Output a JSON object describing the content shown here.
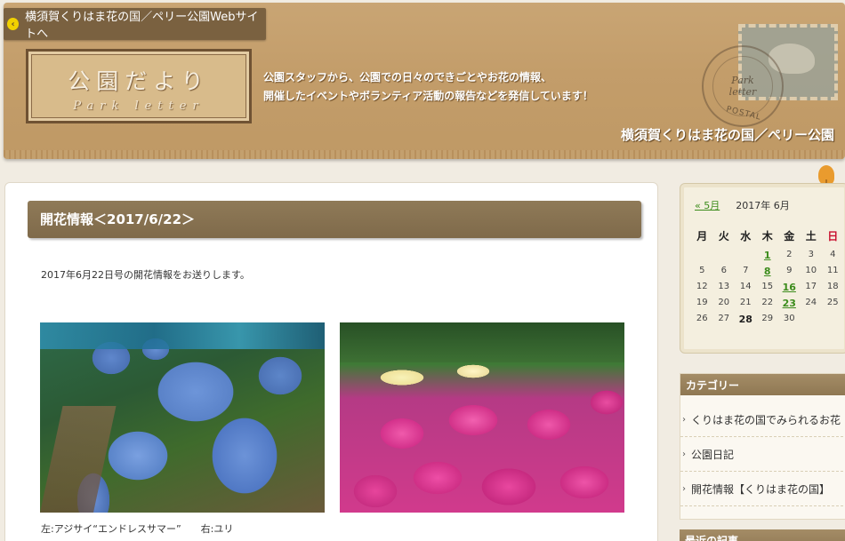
{
  "header": {
    "back_link": "横須賀くりはま花の国／ペリー公園Webサイトへ",
    "logo_title": "公園だより",
    "logo_sub": "Park letter",
    "tagline_line1": "公園スタッフから、公園での日々のできごとやお花の情報、",
    "tagline_line2": "開催したイベントやボランティア活動の報告などを発信しています！",
    "site_name": "横須賀くりはま花の国／ペリー公園",
    "postmark_text1": "Park",
    "postmark_text2": "letter",
    "postmark_text3": "POSTAL"
  },
  "post": {
    "title": "開花情報＜2017/6/22＞",
    "intro": "2017年6月22日号の開花情報をお送りします。",
    "caption": "左:アジサイ“エンドレスサマー”　　右:ユリ"
  },
  "calendar": {
    "prev": "« 5月",
    "current": "2017年 6月",
    "dow": [
      "月",
      "火",
      "水",
      "木",
      "金",
      "土",
      "日"
    ],
    "rows": [
      [
        "",
        "",
        "",
        "1",
        "2",
        "3",
        "4"
      ],
      [
        "5",
        "6",
        "7",
        "8",
        "9",
        "10",
        "11"
      ],
      [
        "12",
        "13",
        "14",
        "15",
        "16",
        "17",
        "18"
      ],
      [
        "19",
        "20",
        "21",
        "22",
        "23",
        "24",
        "25"
      ],
      [
        "26",
        "27",
        "28",
        "29",
        "30",
        "",
        ""
      ]
    ],
    "linked_days": [
      "1",
      "8",
      "16",
      "23"
    ],
    "today": "28"
  },
  "categories": {
    "title": "カテゴリー",
    "items": [
      "くりはま花の国でみられるお花",
      "公園日記",
      "開花情報【くりはま花の国】"
    ]
  },
  "recent": {
    "title": "最近の記事"
  },
  "colors": {
    "header_bg": "#c39d6a",
    "title_bar": "#8a7452",
    "link_green": "#3c8c1c",
    "sunday_red": "#c8102e"
  }
}
